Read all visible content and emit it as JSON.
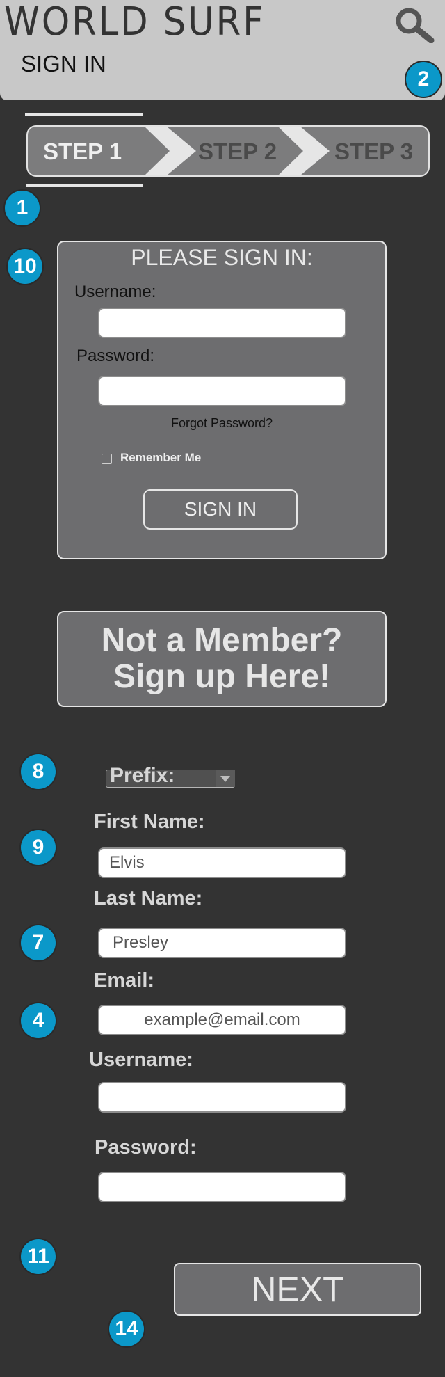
{
  "header": {
    "brand": "WORLD SURF",
    "subtitle": "SIGN IN",
    "search_icon": "search-icon"
  },
  "markers": {
    "m1": "1",
    "m2": "2",
    "m10": "10",
    "m8": "8",
    "m9": "9",
    "m7": "7",
    "m4": "4",
    "m11": "11",
    "m14": "14"
  },
  "steps": {
    "step1": "STEP 1",
    "step2": "STEP 2",
    "step3": "STEP 3",
    "active": "STEP 1"
  },
  "signin_panel": {
    "title": "PLEASE SIGN IN:",
    "username_label": "Username:",
    "username_value": "",
    "password_label": "Password:",
    "password_value": "",
    "forgot_link": "Forgot Password?",
    "remember_label": "Remember Me",
    "remember_checked": false,
    "signin_button": "SIGN IN"
  },
  "signup_banner": {
    "line1": "Not a Member?",
    "line2": "Sign up Here!"
  },
  "register_form": {
    "prefix_label": "Prefix:",
    "first_name_label": "First Name:",
    "first_name_value": "Elvis",
    "last_name_label": "Last Name:",
    "last_name_value": "Presley",
    "email_label": "Email:",
    "email_placeholder": "example@email.com",
    "username_label": "Username:",
    "username_value": "",
    "password_label": "Password:",
    "password_value": "",
    "next_button": "NEXT"
  },
  "colors": {
    "background": "#333333",
    "header": "#c8c8c8",
    "panel": "#6d6d6f",
    "marker": "#0b98c9"
  }
}
